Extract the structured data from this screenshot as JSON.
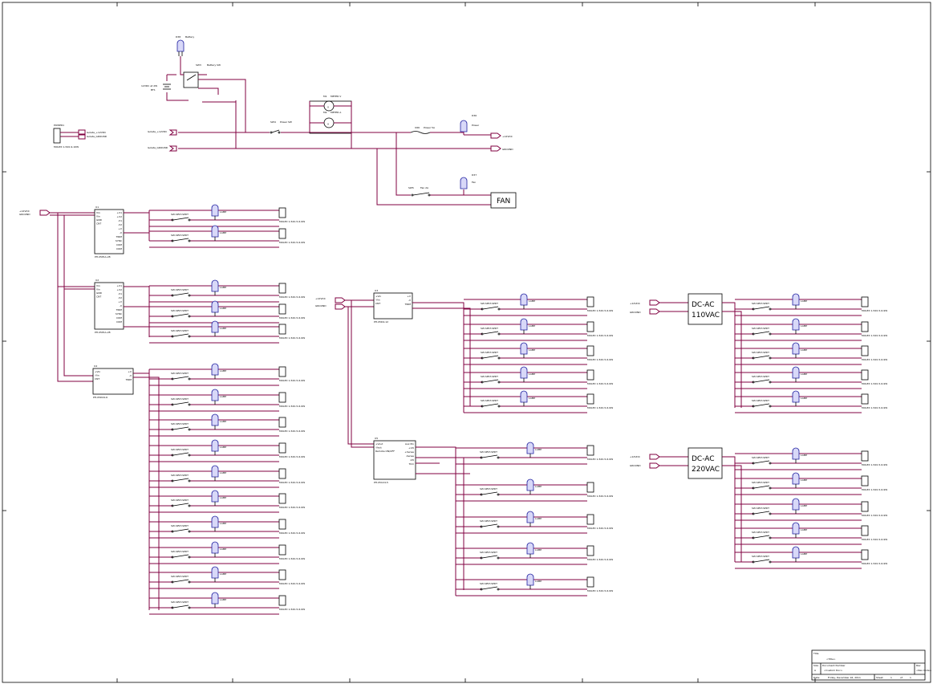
{
  "schematic": {
    "title_block": {
      "size_label": "Size",
      "number_label": "Number",
      "revision_label": "Rev",
      "document_number": "<Doc>",
      "date_label": "Date:",
      "date_value": "Friday, December 16, 2011",
      "sheet_label": "Sheet",
      "of_label": "of",
      "sheet_num": "1",
      "sheet_total": "1",
      "title_label": "Title",
      "title_value": "<Title>",
      "title_size": "A",
      "document_label": "Document Number",
      "document_value": "<Custom Doc>",
      "rev_value": "<Rev Code>"
    },
    "top_section": {
      "battery_led": {
        "ref": "D38",
        "name": "Battery"
      },
      "battery_switch": {
        "ref": "SW3",
        "name": "Battery SW"
      },
      "battery": {
        "ref": "BT1",
        "value": "12VDC at 2W"
      },
      "power_switch": {
        "ref": "SW4",
        "name": "Power SW"
      },
      "fuse": {
        "ref": "U66",
        "name": "Power 5A"
      },
      "fan_switch": {
        "ref": "SW5",
        "name": "Fan 2A"
      },
      "power_led": {
        "ref": "D36",
        "name": "Power"
      },
      "fan_led": {
        "ref": "D37",
        "name": "Fan"
      },
      "fan_label": "FAN",
      "volt_meter": {
        "ref": "M1",
        "name": "METER V",
        "symbol": "V"
      },
      "amp_meter": {
        "ref": "M2",
        "name": "METER A",
        "symbol": "A"
      },
      "input_12v": "Isolate_+12VDC",
      "input_gnd": "Isolate_GROUND",
      "out_12v": "+12VDC",
      "out_gnd": "GROUND",
      "connector": {
        "ref": "POWER1",
        "part": "MOLEX 1-520-9-10W",
        "pin1": "Isolate_+12VDC",
        "pin2": "Isolate_GROUND"
      }
    },
    "left_bus": {
      "v": "+12VDC",
      "g": "GROUND"
    },
    "ics": [
      {
        "ref": "U1",
        "part": "PH-05P1A-28",
        "pins_left": [
          "Vin",
          "Vin",
          "GND",
          "CNT"
        ],
        "pins_right": [
          "+V1",
          "+V2",
          "-V1",
          "-V2",
          "+V",
          "-V",
          "TRIM",
          "SYNC",
          "COM",
          "COM"
        ]
      },
      {
        "ref": "U2",
        "part": "PH-05P1A-28",
        "pins_left": [
          "Vin",
          "Vin",
          "GND",
          "CNT"
        ],
        "pins_right": [
          "+V1",
          "+V2",
          "-V1",
          "-V2",
          "+V",
          "-V",
          "TRIM",
          "SYNC",
          "COM",
          "COM"
        ]
      },
      {
        "ref": "U3",
        "part": "PH-05D4-12",
        "pins_left": [
          "+Vin",
          "-Vin",
          "CNT"
        ],
        "pins_right": [
          "+V",
          "-V",
          "TRIM"
        ]
      },
      {
        "ref": "U4",
        "part": "PH-05D24-6",
        "pins_left": [
          "+Vin",
          "-Vin",
          "CNT"
        ],
        "pins_right": [
          "+V",
          "-V",
          "TRIM"
        ]
      },
      {
        "ref": "U5",
        "part": "PH-05C24-5",
        "pins_left": [
          "+Vout",
          "-Vout",
          "Remote ON/OFF"
        ],
        "pins_right": [
          "Aux Pin",
          "+VO",
          "+Sense",
          "-Sense",
          "-VO",
          "Trim"
        ]
      }
    ],
    "switch_value": "SW-SPST-SPDT",
    "lamp_value": "LAMP",
    "conn_value": "MOLEX 1-520-5-6-9W",
    "dc_ac_110": {
      "line1": "DC-AC",
      "line2": "110VAC"
    },
    "dc_ac_220": {
      "line1": "DC-AC",
      "line2": "220VAC"
    },
    "vdc_mid": {
      "v": "+12VDC",
      "g": "GROUND"
    },
    "vdc_110": {
      "v": "+12VDC",
      "g": "GROUND"
    },
    "vdc_220": {
      "v": "+12VDC",
      "g": "GROUND"
    }
  }
}
